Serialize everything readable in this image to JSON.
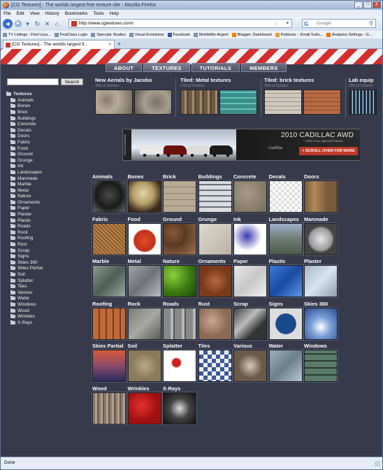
{
  "window": {
    "title": "[CG Textures] - The worlds largest free texture site - Mozilla Firefox",
    "controls": [
      "_",
      "□",
      "X"
    ]
  },
  "menubar": [
    "File",
    "Edit",
    "View",
    "History",
    "Bookmarks",
    "Tools",
    "Help"
  ],
  "navbar": {
    "url": "http://www.cgtextures.com/",
    "search_placeholder": "Google"
  },
  "bookmarks": [
    "TV Listings - Find Loca...",
    "FirstClass Login",
    "Specular Studios",
    "Visual Evolutions",
    "Facebook",
    "MobileMe-Argent",
    "Blogger: Dashboard",
    "Publicize :: Email Subs...",
    "Analytics Settings - G..."
  ],
  "tab": {
    "title": "[CG Textures] - The worlds largest fr..."
  },
  "site": {
    "menu": [
      "ABOUT",
      "TEXTURES",
      "TUTORIALS",
      "MEMBERS"
    ],
    "search_button": "Search",
    "tree_root": "Textures",
    "categories_tree": [
      "Animals",
      "Bones",
      "Brick",
      "Buildings",
      "Concrete",
      "Decals",
      "Doors",
      "Fabric",
      "Food",
      "Ground",
      "Grunge",
      "Ink",
      "Landscapes",
      "Manmade",
      "Marble",
      "Metal",
      "Nature",
      "Ornaments",
      "Paper",
      "Plaster",
      "Plastic",
      "Roads",
      "Rock",
      "Roofing",
      "Rust",
      "Scrap",
      "Signs",
      "Skies 360",
      "Skies Partial",
      "Soil",
      "Splatter",
      "Tiles",
      "Various",
      "Water",
      "Windows",
      "Wood",
      "Wrinkles",
      "X-Rays"
    ],
    "featured": [
      {
        "title": "New Aerials by Jacobo",
        "date": "28th of October"
      },
      {
        "title": "Tiled: Metal textures",
        "date": "27th of October"
      },
      {
        "title": "Tiled: brick textures",
        "date": "26th of October"
      },
      {
        "title": "Lab equip",
        "date": "25th of October"
      }
    ],
    "ad": {
      "side": "FIND A DEALER",
      "headline": "2010 CADILLAC AWD",
      "sub": "* AWD is an optional feature.",
      "brand": "Cadillac",
      "cta": "> SCROLL OVER FOR MORE"
    },
    "grid": [
      "Animals",
      "Bones",
      "Brick",
      "Buildings",
      "Concrete",
      "Decals",
      "Doors",
      "Fabric",
      "Food",
      "Ground",
      "Grunge",
      "Ink",
      "Landscapes",
      "Manmade",
      "Marble",
      "Metal",
      "Nature",
      "Ornaments",
      "Paper",
      "Plastic",
      "Plaster",
      "Roofing",
      "Rock",
      "Roads",
      "Rust",
      "Scrap",
      "Signs",
      "Skies 360",
      "Skies Partial",
      "Soil",
      "Splatter",
      "Tiles",
      "Various",
      "Water",
      "Windows",
      "Wood",
      "Wrinkles",
      "X-Rays"
    ]
  },
  "status": "Done"
}
